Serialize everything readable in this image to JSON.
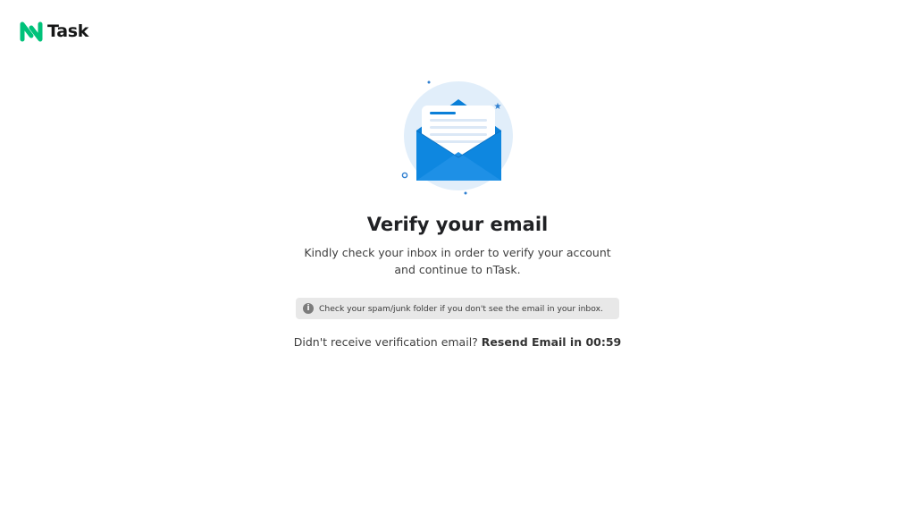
{
  "brand": {
    "name": "Task",
    "accent": "#00c27a"
  },
  "illustration": {
    "icon": "open-envelope-icon",
    "envelope_color": "#0a7fd8",
    "circle_color": "#e1eefa"
  },
  "main": {
    "title": "Verify your email",
    "description_line1": "Kindly check your inbox in order to verify your account",
    "description_line2": "and continue to nTask."
  },
  "note": {
    "icon": "info-icon",
    "icon_glyph": "i",
    "text": "Check your spam/junk folder if you don't see the email in your inbox."
  },
  "resend": {
    "prompt": "Didn't receive verification email? ",
    "link_label": "Resend Email in 00:59"
  }
}
